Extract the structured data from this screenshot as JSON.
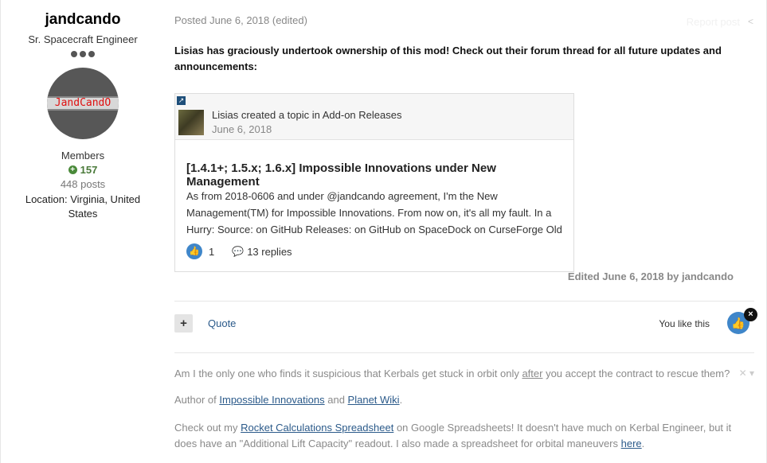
{
  "author": {
    "name": "jandcando",
    "title": "Sr. Spacecraft Engineer",
    "avatar_text": "JandCandO",
    "group": "Members",
    "reputation": "157",
    "posts": "448 posts",
    "location_line1": "Location: Virginia, United",
    "location_line2": "States"
  },
  "post": {
    "posted": "Posted June 6, 2018 (edited)",
    "report": "Report post",
    "intro": "Lisias has graciously undertook ownership of this mod! Check out their forum thread for all future updates and announcements:",
    "embed": {
      "who": "Lisias created a topic in Add-on Releases",
      "date": "June 6, 2018",
      "title": "[1.4.1+; 1.5.x; 1.6.x] Impossible Innovations under New Management",
      "body": "As from 2018-0606 and under @jandcando agreement, I'm the New Management(TM) for Impossible Innovations. From now on, it's all my fault.  In a Hurry: Source: on GitHub Releases: on GitHub on SpaceDock on CurseForge Old …",
      "likes": "1",
      "replies": "13 replies"
    },
    "edited": "Edited June 6, 2018 by jandcando",
    "quote_label": "Quote",
    "you_like": "You like this"
  },
  "signature": {
    "line1_pre": "Am I the only one who finds it suspicious that Kerbals get stuck in orbit only ",
    "line1_u": "after",
    "line1_post": " you accept the contract to rescue them?",
    "line2_pre": "Author of ",
    "line2_link1": "Impossible Innovations",
    "line2_mid": " and ",
    "line2_link2": "Planet Wiki",
    "line2_post": ".",
    "line3_pre": "Check out my ",
    "line3_link1": "Rocket Calculations Spreadsheet",
    "line3_mid": " on Google Spreadsheets! It doesn't have much on Kerbal Engineer, but it does have an \"Additional Lift Capacity\" readout. I also made a spreadsheet for orbital maneuvers ",
    "line3_link2": "here",
    "line3_post": "."
  },
  "icons": {
    "rep": "plus-circle-icon",
    "like": "thumbs-up-icon",
    "reply": "comment-icon",
    "share": "share-icon",
    "close": "close-icon",
    "link": "external-link-icon"
  }
}
